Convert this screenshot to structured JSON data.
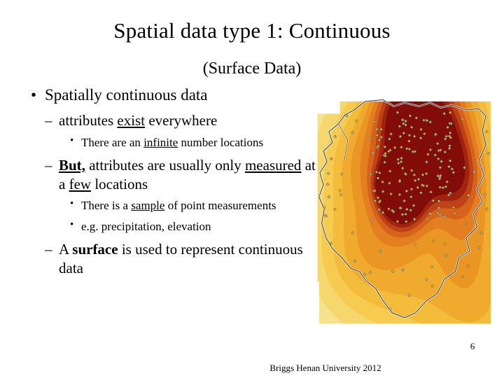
{
  "slide": {
    "title": "Spatial data type 1: Continuous",
    "subtitle": "(Surface Data)",
    "page_number": "6",
    "footer": "Briggs  Henan University 2012",
    "bullets": [
      {
        "level": 1,
        "marker": "•",
        "parts": [
          {
            "text": "Spatially continuous data",
            "style": "normal"
          }
        ]
      },
      {
        "level": 2,
        "marker": "–",
        "parts": [
          {
            "text": "attributes ",
            "style": "normal"
          },
          {
            "text": "exist",
            "style": "underline"
          },
          {
            "text": " everywhere",
            "style": "normal"
          }
        ]
      },
      {
        "level": 3,
        "marker": "•",
        "parts": [
          {
            "text": "There are an ",
            "style": "normal"
          },
          {
            "text": "infinite",
            "style": "underline"
          },
          {
            "text": " number locations",
            "style": "normal"
          }
        ]
      },
      {
        "level": 2,
        "marker": "–",
        "parts": [
          {
            "text": "But,",
            "style": "bold-underline"
          },
          {
            "text": " attributes are usually only ",
            "style": "normal"
          },
          {
            "text": "measured",
            "style": "underline"
          },
          {
            "text": " at a ",
            "style": "normal"
          },
          {
            "text": "few",
            "style": "underline"
          },
          {
            "text": " locations",
            "style": "normal"
          }
        ]
      },
      {
        "level": 3,
        "marker": "•",
        "parts": [
          {
            "text": "There is a ",
            "style": "normal"
          },
          {
            "text": "sample",
            "style": "underline"
          },
          {
            "text": " of point measurements",
            "style": "normal"
          }
        ]
      },
      {
        "level": 3,
        "marker": "•",
        "parts": [
          {
            "text": "e.g. precipitation, elevation",
            "style": "normal"
          }
        ]
      },
      {
        "level": 2,
        "marker": "–",
        "parts": [
          {
            "text": "A ",
            "style": "normal"
          },
          {
            "text": "surface",
            "style": "bold"
          },
          {
            "text": " is used to represent continuous data",
            "style": "normal"
          }
        ]
      }
    ]
  },
  "map": {
    "alt_label": "interpolated-precipitation-surface-with-sample-points",
    "colors": {
      "low": "#f5c13c",
      "mid": "#e8972e",
      "high": "#c9461b",
      "peak": "#8e1208",
      "background": "#ffffff",
      "boundary": "#3a3a3a",
      "point_fill": "#f3b43a",
      "point_stroke": "#3f5d63"
    }
  }
}
